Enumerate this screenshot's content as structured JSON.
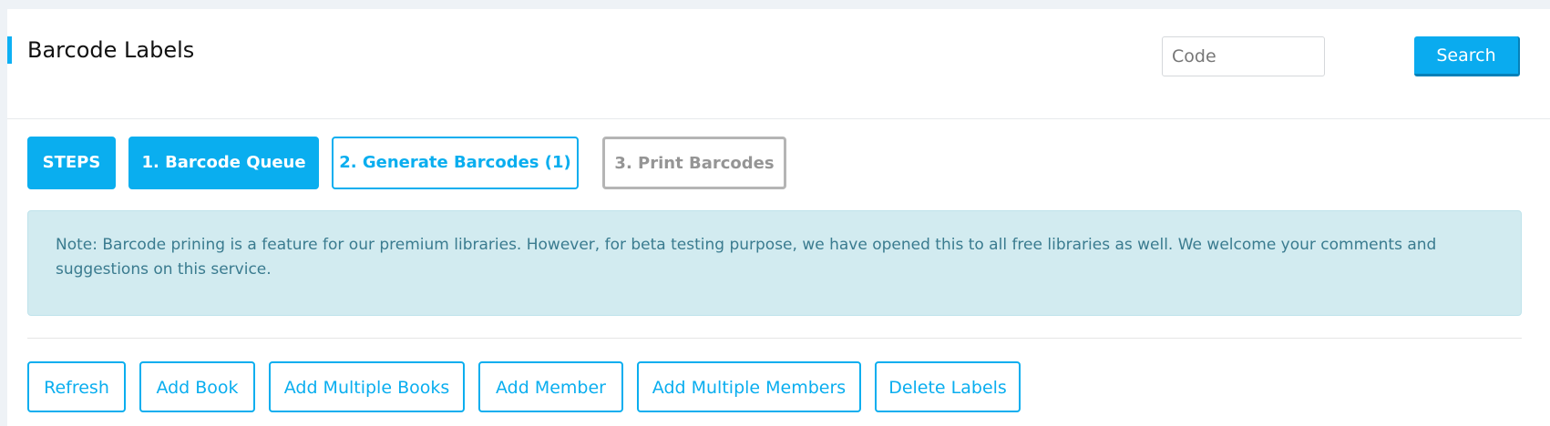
{
  "header": {
    "title": "Barcode Labels",
    "search_placeholder": "Code",
    "search_label": "Search"
  },
  "steps": {
    "label": "STEPS",
    "items": [
      {
        "label": "1. Barcode Queue",
        "state": "active"
      },
      {
        "label": "2. Generate Barcodes (1)",
        "state": "available"
      },
      {
        "label": "3. Print Barcodes",
        "state": "disabled"
      }
    ]
  },
  "note": {
    "text": "Note: Barcode prining is a feature for our premium libraries. However, for beta testing purpose, we have opened this to all free libraries as well. We welcome your comments and suggestions on this service."
  },
  "actions": {
    "refresh": "Refresh",
    "add_book": "Add Book",
    "add_multiple_books": "Add Multiple Books",
    "add_member": "Add Member",
    "add_multiple_members": "Add Multiple Members",
    "delete_labels": "Delete Labels"
  },
  "colors": {
    "accent": "#0aaeef",
    "note_background": "#d2ebf0",
    "note_text": "#3a7b8f",
    "disabled_border": "#b5b5b5"
  }
}
